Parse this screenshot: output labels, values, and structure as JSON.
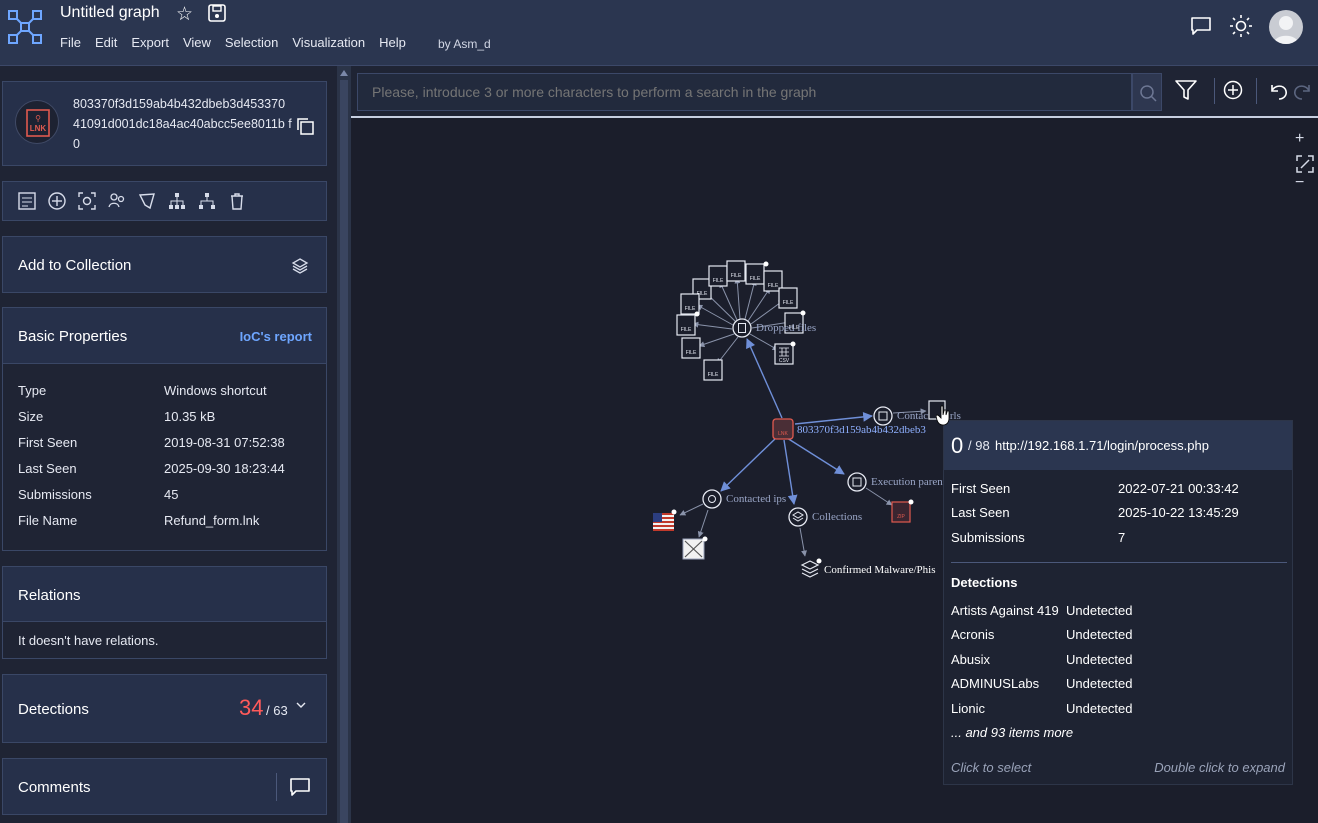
{
  "app": {
    "title": "Untitled graph",
    "menu": [
      "File",
      "Edit",
      "Export",
      "View",
      "Selection",
      "Visualization",
      "Help"
    ],
    "byline": "by  Asm_d"
  },
  "sidebar": {
    "hash": "803370f3d159ab4b432dbeb3d453370 41091d001dc18a4ac40abcc5ee8011b f0",
    "hash_icon_label": "LNK",
    "add_to_collection": "Add to Collection",
    "basic_properties": {
      "title": "Basic Properties",
      "ioc_link": "IoC's report",
      "rows": [
        {
          "k": "Type",
          "v": "Windows shortcut"
        },
        {
          "k": "Size",
          "v": "10.35 kB"
        },
        {
          "k": "First Seen",
          "v": "2019-08-31 07:52:38"
        },
        {
          "k": "Last Seen",
          "v": "2025-09-30 18:23:44"
        },
        {
          "k": "Submissions",
          "v": "45"
        },
        {
          "k": "File Name",
          "v": "Refund_form.lnk"
        }
      ]
    },
    "relations": {
      "title": "Relations",
      "empty": "It doesn't have relations."
    },
    "detections": {
      "title": "Detections",
      "count": "34",
      "total": "/ 63"
    },
    "comments": {
      "title": "Comments"
    }
  },
  "search": {
    "placeholder": "Please, introduce 3 or more characters to perform a search in the graph"
  },
  "zoom": {
    "in": "+",
    "out": "−"
  },
  "graph": {
    "root_label": "803370f3d159ab4b432dbeb3",
    "root_icon": "LNK",
    "dropped_files_label": "Dropped files",
    "contacted_urls_label": "Contacted urls",
    "execution_parents_label": "Execution parents",
    "contacted_ips_label": "Contacted ips",
    "collections_label": "Collections",
    "confirmed_label": "Confirmed Malware/Phis",
    "file_icon": "FILE",
    "csv_icon": "CSV",
    "zip_icon": "ZIP"
  },
  "tooltip": {
    "positives": "0",
    "total": "/ 98",
    "url": "http://192.168.1.71/login/process.php",
    "rows": [
      {
        "k": "First Seen",
        "v": "2022-07-21 00:33:42"
      },
      {
        "k": "Last Seen",
        "v": "2025-10-22 13:45:29"
      },
      {
        "k": "Submissions",
        "v": "7"
      }
    ],
    "detections_title": "Detections",
    "engines": [
      {
        "k": "Artists Against 419",
        "v": "Undetected"
      },
      {
        "k": "Acronis",
        "v": "Undetected"
      },
      {
        "k": "Abusix",
        "v": "Undetected"
      },
      {
        "k": "ADMINUSLabs",
        "v": "Undetected"
      },
      {
        "k": "Lionic",
        "v": "Undetected"
      }
    ],
    "more": "... and 93 items more",
    "click_hint": "Click to select",
    "dbl_hint": "Double click to expand"
  },
  "colors": {
    "accent": "#6ea6ff",
    "danger": "#ff5a5a",
    "topbar": "#2b3650",
    "canvas": "#1b1e2b"
  }
}
